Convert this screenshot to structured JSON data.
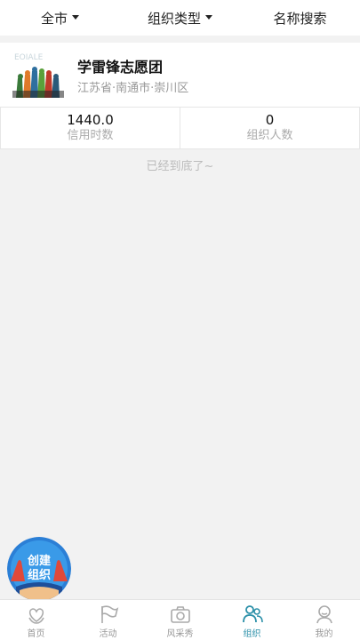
{
  "filters": {
    "city": "全市",
    "org_type": "组织类型",
    "search": "名称搜索"
  },
  "org": {
    "name": "学雷锋志愿团",
    "address": "江苏省·南通市·崇川区",
    "stats": [
      {
        "value": "1440.0",
        "label": "信用时数"
      },
      {
        "value": "0",
        "label": "组织人数"
      }
    ]
  },
  "list_end": "已经到底了~",
  "fab": {
    "line1": "创建",
    "line2": "组织"
  },
  "tabs": [
    {
      "label": "首页",
      "icon": "heart-hands-icon"
    },
    {
      "label": "活动",
      "icon": "flag-icon"
    },
    {
      "label": "风采秀",
      "icon": "camera-icon"
    },
    {
      "label": "组织",
      "icon": "group-icon",
      "active": true
    },
    {
      "label": "我的",
      "icon": "profile-icon"
    }
  ],
  "colors": {
    "active_tab": "#2a8fa8",
    "background": "#f2f2f2"
  }
}
